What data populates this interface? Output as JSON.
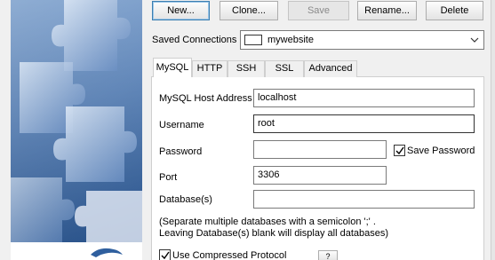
{
  "toolbar": {
    "new_label": "New...",
    "clone_label": "Clone...",
    "save_label": "Save",
    "rename_label": "Rename...",
    "delete_label": "Delete"
  },
  "saved_connections": {
    "label": "Saved Connections",
    "value": "mywebsite",
    "swatch_color": "#ffffff"
  },
  "tabs": [
    {
      "label": "MySQL",
      "active": true
    },
    {
      "label": "HTTP",
      "active": false
    },
    {
      "label": "SSH",
      "active": false
    },
    {
      "label": "SSL",
      "active": false
    },
    {
      "label": "Advanced",
      "active": false
    }
  ],
  "form": {
    "host_label": "MySQL Host Address",
    "host_value": "localhost",
    "username_label": "Username",
    "username_value": "root",
    "password_label": "Password",
    "password_value": "",
    "save_password_label": "Save Password",
    "save_password_checked": true,
    "port_label": "Port",
    "port_value": "3306",
    "databases_label": "Database(s)",
    "databases_value": "",
    "help_line1": "(Separate multiple databases with a semicolon ';' .",
    "help_line2": "Leaving Database(s) blank will display all databases)",
    "compressed_label": "Use Compressed Protocol",
    "compressed_checked": true,
    "help_button_label": "?"
  },
  "colors": {
    "window_bg": "#f0f0f0",
    "accent_border": "#3c7fb1",
    "banner_blue": "#2f5f9e"
  },
  "icons": [
    "puzzle-banner-image",
    "chevron-down-icon",
    "checkmark-icon",
    "dolphin-logo-icon"
  ]
}
